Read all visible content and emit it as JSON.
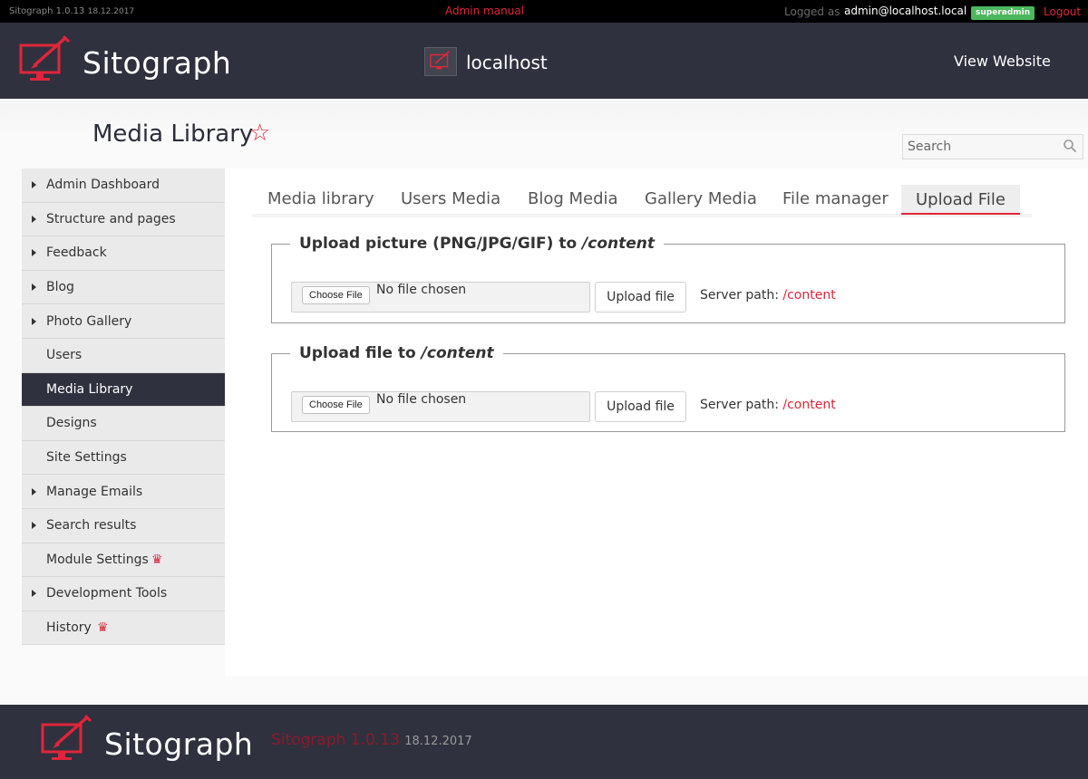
{
  "topbar": {
    "version": "Sitograph 1.0.13",
    "version_date": "18.12.2017",
    "admin_manual": "Admin manual",
    "logged_as": "Logged as",
    "user": "admin@localhost.local",
    "role_badge": "superadmin",
    "logout": "Logout"
  },
  "header": {
    "logo_text": "Sitograph",
    "site_name": "localhost",
    "view_website": "View Website"
  },
  "page": {
    "title": "Media Library",
    "favorite_icon": "star-icon"
  },
  "search": {
    "placeholder": "Search"
  },
  "sidebar": {
    "items": [
      {
        "label": "Admin Dashboard",
        "has_arrow": true
      },
      {
        "label": "Structure and pages",
        "has_arrow": true
      },
      {
        "label": "Feedback",
        "has_arrow": true
      },
      {
        "label": "Blog",
        "has_arrow": true
      },
      {
        "label": "Photo Gallery",
        "has_arrow": true
      },
      {
        "label": "Users",
        "has_arrow": false
      },
      {
        "label": "Media Library",
        "has_arrow": false,
        "active": true
      },
      {
        "label": "Designs",
        "has_arrow": false
      },
      {
        "label": "Site Settings",
        "has_arrow": false
      },
      {
        "label": "Manage Emails",
        "has_arrow": true
      },
      {
        "label": "Search results",
        "has_arrow": true
      },
      {
        "label": "Module Settings",
        "has_arrow": false,
        "icon": "crown-icon"
      },
      {
        "label": "Development Tools",
        "has_arrow": true
      },
      {
        "label": "History",
        "has_arrow": false,
        "icon": "crown-icon"
      }
    ]
  },
  "tabs": [
    {
      "label": "Media library"
    },
    {
      "label": "Users Media"
    },
    {
      "label": "Blog Media"
    },
    {
      "label": "Gallery Media"
    },
    {
      "label": "File manager"
    },
    {
      "label": "Upload File",
      "active": true
    }
  ],
  "upload_picture": {
    "legend": "Upload picture (PNG/JPG/GIF) to",
    "legend_path": "/content",
    "choose_label": "Choose File",
    "no_file": "No file chosen",
    "upload_label": "Upload file",
    "server_path_label": "Server path:",
    "server_path": "/content"
  },
  "upload_file": {
    "legend": "Upload file to",
    "legend_path": "/content",
    "choose_label": "Choose File",
    "no_file": "No file chosen",
    "upload_label": "Upload file",
    "server_path_label": "Server path:",
    "server_path": "/content"
  },
  "footer": {
    "logo_text": "Sitograph",
    "version": "Sitograph 1.0.13",
    "date": "18.12.2017"
  },
  "colors": {
    "accent": "#e0253a",
    "header_bg": "#2f313e",
    "badge": "#4cb75c"
  }
}
